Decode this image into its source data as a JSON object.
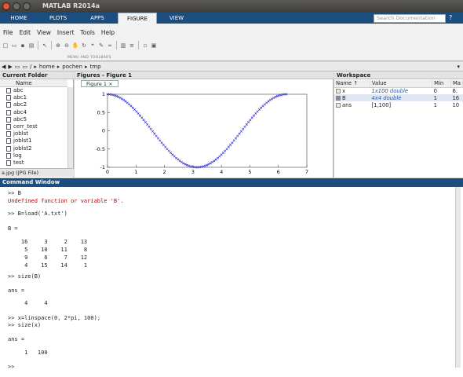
{
  "window": {
    "title": "MATLAB R2014a"
  },
  "tabs": [
    "HOME",
    "PLOTS",
    "APPS",
    "FIGURE",
    "VIEW"
  ],
  "search": {
    "placeholder": "Search Documentation"
  },
  "menu": [
    "File",
    "Edit",
    "View",
    "Insert",
    "Tools",
    "Help"
  ],
  "ribbon_label": "MENU AND TOOLBARS",
  "path": [
    "/",
    "home",
    "pochen",
    "tmp"
  ],
  "current_folder": {
    "title": "Current Folder",
    "column": "Name",
    "items": [
      "abc",
      "abc1",
      "abc2",
      "abc4",
      "abc5",
      "cerr_test",
      "joblst",
      "joblst1",
      "joblst2",
      "log",
      "test"
    ],
    "footer": "a.jpg (JPG File)"
  },
  "figures": {
    "title": "Figures - Figure 1",
    "tab": "Figure 1"
  },
  "chart_data": {
    "type": "scatter",
    "series": [
      {
        "function": "cos(x)",
        "x_range": [
          0,
          6.283
        ],
        "count": 100
      }
    ],
    "xlim": [
      0,
      7
    ],
    "ylim": [
      -1,
      1
    ],
    "xticks": [
      "0",
      "1",
      "2",
      "3",
      "4",
      "5",
      "6",
      "7"
    ],
    "yticks": [
      "1",
      "0.5",
      "0",
      "-0.5",
      "-1"
    ],
    "marker_color": "#1f1fd0",
    "grid": false
  },
  "workspace": {
    "title": "Workspace",
    "columns": [
      "Name ↑",
      "Value",
      "Min",
      "Ma"
    ],
    "rows": [
      {
        "name": "x",
        "value": "1x100 double",
        "min": "0",
        "max": "6."
      },
      {
        "name": "B",
        "value": "4x4 double",
        "min": "1",
        "max": "16"
      },
      {
        "name": "ans",
        "value": "[1,100]",
        "min": "1",
        "max": "10"
      }
    ]
  },
  "command_window": {
    "title": "Command Window",
    "lines": [
      {
        "t": ">> B",
        "type": "cmd"
      },
      {
        "t": "Undefined function or variable 'B'.",
        "type": "err"
      },
      {
        "t": ">> B=load('A.txt')",
        "type": "cmd"
      },
      {
        "t": "B =",
        "type": "out"
      },
      {
        "t": "    16     3     2    13",
        "type": "out"
      },
      {
        "t": "     5    10    11     8",
        "type": "out"
      },
      {
        "t": "     9     6     7    12",
        "type": "out"
      },
      {
        "t": "     4    15    14     1",
        "type": "out"
      },
      {
        "t": ">> size(B)",
        "type": "cmd"
      },
      {
        "t": "ans =",
        "type": "out"
      },
      {
        "t": "     4     4",
        "type": "out"
      },
      {
        "t": ">> x=linspace(0, 2*pi, 100);",
        "type": "cmd"
      },
      {
        "t": ">> size(x)",
        "type": "cmd"
      },
      {
        "t": "ans =",
        "type": "out"
      },
      {
        "t": "     1   100",
        "type": "out"
      },
      {
        "t": ">>",
        "type": "cmd"
      }
    ]
  }
}
